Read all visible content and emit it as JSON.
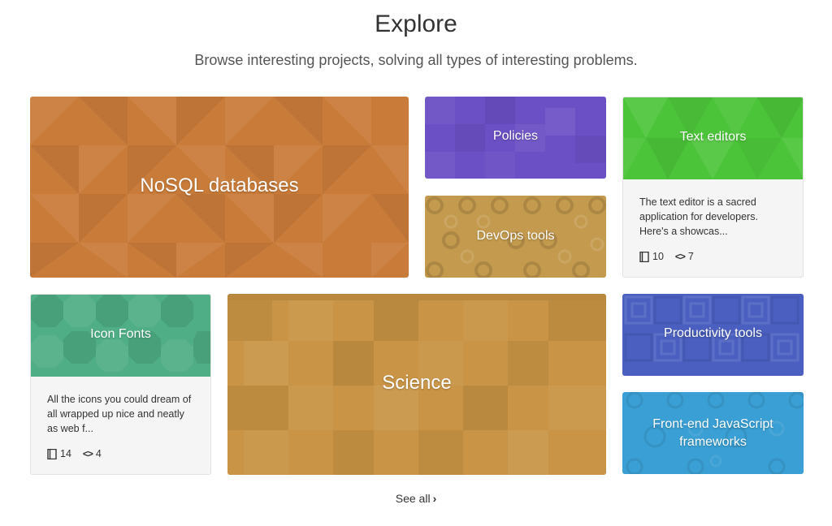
{
  "header": {
    "title": "Explore",
    "subtitle": "Browse interesting projects, solving all types of interesting problems."
  },
  "collections": {
    "nosql": {
      "label": "NoSQL databases",
      "color": "#c97c3a"
    },
    "policies": {
      "label": "Policies",
      "color": "#6b4fc4"
    },
    "devops": {
      "label": "DevOps tools",
      "color": "#c49a4e"
    },
    "text_editors": {
      "label": "Text editors",
      "color": "#4cc43a",
      "description": "The text editor is a sacred application for developers. Here's a showcas...",
      "repos": "10",
      "languages": "7"
    },
    "icon_fonts": {
      "label": "Icon Fonts",
      "color": "#4fae86",
      "description": "All the icons you could dream of all wrapped up nice and neatly as web f...",
      "repos": "14",
      "languages": "4"
    },
    "science": {
      "label": "Science",
      "color": "#c99445"
    },
    "productivity": {
      "label": "Productivity tools",
      "color": "#4a5fc0"
    },
    "frontend_js": {
      "label": "Front-end JavaScript frameworks",
      "color": "#3a9fd4"
    }
  },
  "footer": {
    "see_all": "See all",
    "see_all_icon": "chevron-right-icon"
  }
}
